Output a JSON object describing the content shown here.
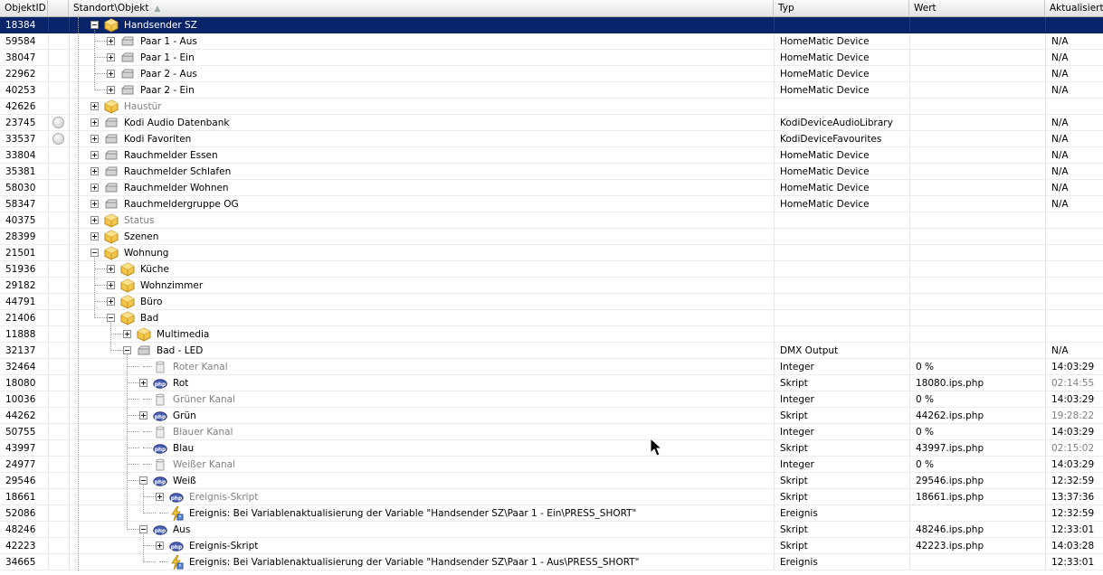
{
  "columns": {
    "id": "ObjektID",
    "status": "",
    "object": "Standort\\Objekt",
    "sort_glyph": "▲",
    "type": "Typ",
    "value": "Wert",
    "updated": "Aktualisiert"
  },
  "rows": [
    {
      "id": "18384",
      "depth": 1,
      "expander": "minus",
      "icon": "category",
      "label": "Handsender SZ",
      "type": "",
      "value": "",
      "updated": "",
      "selected": true
    },
    {
      "id": "59584",
      "depth": 2,
      "expander": "plus",
      "icon": "device",
      "label": "Paar 1 - Aus",
      "type": "HomeMatic Device",
      "value": "",
      "updated": "N/A"
    },
    {
      "id": "38047",
      "depth": 2,
      "expander": "plus",
      "icon": "device",
      "label": "Paar 1 - Ein",
      "type": "HomeMatic Device",
      "value": "",
      "updated": "N/A"
    },
    {
      "id": "22962",
      "depth": 2,
      "expander": "plus",
      "icon": "device",
      "label": "Paar 2 - Aus",
      "type": "HomeMatic Device",
      "value": "",
      "updated": "N/A"
    },
    {
      "id": "40253",
      "depth": 2,
      "expander": "plus",
      "icon": "device",
      "label": "Paar 2 - Ein",
      "type": "HomeMatic Device",
      "value": "",
      "updated": "N/A"
    },
    {
      "id": "42626",
      "depth": 1,
      "expander": "plus",
      "icon": "category",
      "label": "Haustür",
      "type": "",
      "value": "",
      "updated": "",
      "dim": true
    },
    {
      "id": "23745",
      "depth": 1,
      "expander": "plus",
      "icon": "device",
      "label": "Kodi Audio Datenbank",
      "type": "KodiDeviceAudioLibrary",
      "value": "",
      "updated": "N/A",
      "status": true
    },
    {
      "id": "33537",
      "depth": 1,
      "expander": "plus",
      "icon": "device",
      "label": "Kodi Favoriten",
      "type": "KodiDeviceFavourites",
      "value": "",
      "updated": "N/A",
      "status": true
    },
    {
      "id": "33804",
      "depth": 1,
      "expander": "plus",
      "icon": "device",
      "label": "Rauchmelder Essen",
      "type": "HomeMatic Device",
      "value": "",
      "updated": "N/A"
    },
    {
      "id": "35381",
      "depth": 1,
      "expander": "plus",
      "icon": "device",
      "label": "Rauchmelder Schlafen",
      "type": "HomeMatic Device",
      "value": "",
      "updated": "N/A"
    },
    {
      "id": "58030",
      "depth": 1,
      "expander": "plus",
      "icon": "device",
      "label": "Rauchmelder Wohnen",
      "type": "HomeMatic Device",
      "value": "",
      "updated": "N/A"
    },
    {
      "id": "58347",
      "depth": 1,
      "expander": "plus",
      "icon": "device",
      "label": "Rauchmeldergruppe OG",
      "type": "HomeMatic Device",
      "value": "",
      "updated": "N/A"
    },
    {
      "id": "40375",
      "depth": 1,
      "expander": "plus",
      "icon": "category",
      "label": "Status",
      "type": "",
      "value": "",
      "updated": "",
      "dim": true
    },
    {
      "id": "28399",
      "depth": 1,
      "expander": "plus",
      "icon": "category",
      "label": "Szenen",
      "type": "",
      "value": "",
      "updated": ""
    },
    {
      "id": "21501",
      "depth": 1,
      "expander": "minus",
      "icon": "category",
      "label": "Wohnung",
      "type": "",
      "value": "",
      "updated": ""
    },
    {
      "id": "51936",
      "depth": 2,
      "expander": "plus",
      "icon": "category",
      "label": "Küche",
      "type": "",
      "value": "",
      "updated": ""
    },
    {
      "id": "29182",
      "depth": 2,
      "expander": "plus",
      "icon": "category",
      "label": "Wohnzimmer",
      "type": "",
      "value": "",
      "updated": ""
    },
    {
      "id": "44791",
      "depth": 2,
      "expander": "plus",
      "icon": "category",
      "label": "Büro",
      "type": "",
      "value": "",
      "updated": ""
    },
    {
      "id": "21406",
      "depth": 2,
      "expander": "minus",
      "icon": "category",
      "label": "Bad",
      "type": "",
      "value": "",
      "updated": ""
    },
    {
      "id": "11888",
      "depth": 3,
      "expander": "plus",
      "icon": "category",
      "label": "Multimedia",
      "type": "",
      "value": "",
      "updated": ""
    },
    {
      "id": "32137",
      "depth": 3,
      "expander": "minus",
      "icon": "device",
      "label": "Bad - LED",
      "type": "DMX Output",
      "value": "",
      "updated": "N/A"
    },
    {
      "id": "32464",
      "depth": 4,
      "expander": "none",
      "icon": "variable",
      "label": "Roter Kanal",
      "type": "Integer",
      "value": "0 %",
      "updated": "14:03:29",
      "dim": true
    },
    {
      "id": "18080",
      "depth": 4,
      "expander": "plus",
      "icon": "script",
      "label": "Rot",
      "type": "Skript",
      "value": "18080.ips.php",
      "updated": "02:14:55",
      "updated_dim": true
    },
    {
      "id": "10036",
      "depth": 4,
      "expander": "none",
      "icon": "variable",
      "label": "Grüner Kanal",
      "type": "Integer",
      "value": "0 %",
      "updated": "14:03:29",
      "dim": true
    },
    {
      "id": "44262",
      "depth": 4,
      "expander": "plus",
      "icon": "script",
      "label": "Grün",
      "type": "Skript",
      "value": "44262.ips.php",
      "updated": "19:28:22",
      "updated_dim": true
    },
    {
      "id": "50755",
      "depth": 4,
      "expander": "none",
      "icon": "variable",
      "label": "Blauer Kanal",
      "type": "Integer",
      "value": "0 %",
      "updated": "14:03:29",
      "dim": true
    },
    {
      "id": "43997",
      "depth": 4,
      "expander": "none",
      "icon": "script",
      "label": "Blau",
      "type": "Skript",
      "value": "43997.ips.php",
      "updated": "02:15:02",
      "updated_dim": true
    },
    {
      "id": "24977",
      "depth": 4,
      "expander": "none",
      "icon": "variable",
      "label": "Weißer Kanal",
      "type": "Integer",
      "value": "0 %",
      "updated": "14:03:29",
      "dim": true
    },
    {
      "id": "29546",
      "depth": 4,
      "expander": "minus",
      "icon": "script",
      "label": "Weiß",
      "type": "Skript",
      "value": "29546.ips.php",
      "updated": "12:32:59"
    },
    {
      "id": "18661",
      "depth": 5,
      "expander": "plus",
      "icon": "script",
      "label": "Ereignis-Skript",
      "type": "Skript",
      "value": "18661.ips.php",
      "updated": "13:37:36",
      "dim": true
    },
    {
      "id": "52086",
      "depth": 5,
      "expander": "none",
      "icon": "event",
      "label": "Ereignis: Bei Variablenaktualisierung der Variable \"Handsender SZ\\Paar 1 - Ein\\PRESS_SHORT\"",
      "type": "Ereignis",
      "value": "",
      "updated": "12:32:59"
    },
    {
      "id": "48246",
      "depth": 4,
      "expander": "minus",
      "icon": "script",
      "label": "Aus",
      "type": "Skript",
      "value": "48246.ips.php",
      "updated": "12:33:01"
    },
    {
      "id": "42223",
      "depth": 5,
      "expander": "plus",
      "icon": "script",
      "label": "Ereignis-Skript",
      "type": "Skript",
      "value": "42223.ips.php",
      "updated": "14:03:28"
    },
    {
      "id": "34665",
      "depth": 5,
      "expander": "none",
      "icon": "event",
      "label": "Ereignis: Bei Variablenaktualisierung der Variable \"Handsender SZ\\Paar 1 - Aus\\PRESS_SHORT\"",
      "type": "Ereignis",
      "value": "",
      "updated": "12:33:01"
    }
  ],
  "colors": {
    "selection": "#0a246a",
    "category_icon": "#f2c64a",
    "script_icon": "#4a5fb0",
    "dim_text": "#808080"
  }
}
